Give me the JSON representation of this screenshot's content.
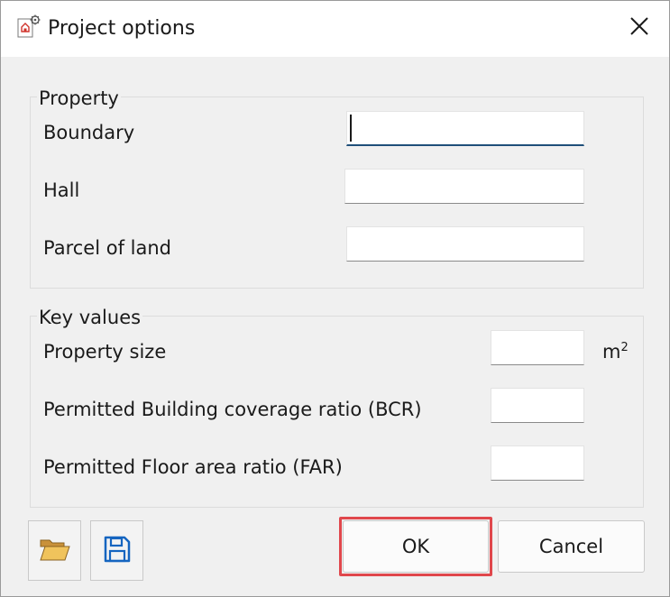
{
  "window": {
    "title": "Project options",
    "app_icon": "project-settings-icon",
    "close_icon": "close-icon"
  },
  "property_group": {
    "legend": "Property",
    "fields": [
      {
        "label": "Boundary",
        "value": "",
        "focused": true
      },
      {
        "label": "Hall",
        "value": ""
      },
      {
        "label": "Parcel of land",
        "value": ""
      }
    ]
  },
  "key_values_group": {
    "legend": "Key values",
    "fields": [
      {
        "label": "Property size",
        "value": "",
        "unit": "m",
        "unit_sup": "2"
      },
      {
        "label": "Permitted Building coverage ratio (BCR)",
        "value": ""
      },
      {
        "label": "Permitted Floor area ratio (FAR)",
        "value": ""
      }
    ]
  },
  "footer": {
    "open_icon": "folder-open-icon",
    "save_icon": "floppy-disk-save-icon",
    "ok_label": "OK",
    "cancel_label": "Cancel"
  },
  "colors": {
    "highlight": "#e0474c",
    "focus_underline": "#1f4f7a",
    "save_icon": "#1565c0",
    "folder_icon": "#e2b04a"
  }
}
